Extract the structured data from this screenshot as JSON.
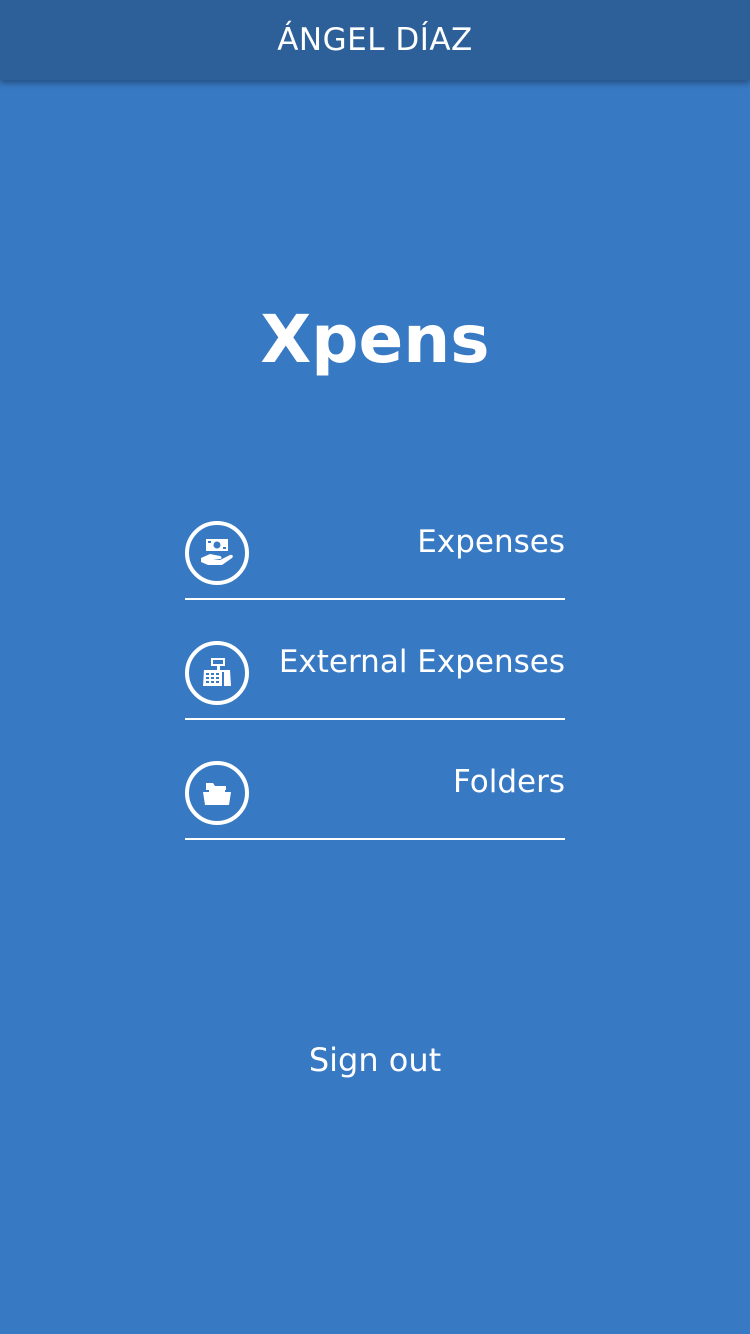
{
  "header": {
    "title": "ÁNGEL DÍAZ"
  },
  "app": {
    "name": "Xpens"
  },
  "menu": {
    "items": [
      {
        "label": "Expenses",
        "icon": "money-hand-icon"
      },
      {
        "label": "External Expenses",
        "icon": "cash-register-icon"
      },
      {
        "label": "Folders",
        "icon": "open-folder-icon"
      }
    ]
  },
  "footer": {
    "signout_label": "Sign out"
  },
  "colors": {
    "background": "#3879c4",
    "app_bar": "#2d6099",
    "foreground": "#ffffff"
  }
}
